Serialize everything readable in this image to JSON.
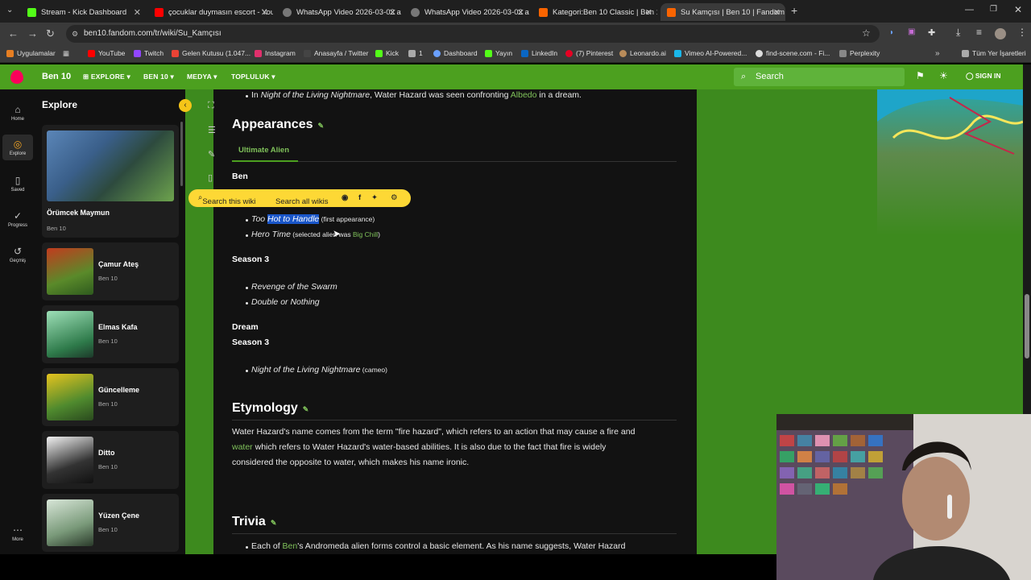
{
  "browser": {
    "tabs": [
      {
        "label": "Stream - Kick Dashboard",
        "color": "#53fc18"
      },
      {
        "label": "çocuklar duymasın escort - You",
        "color": "#ff0000"
      },
      {
        "label": "WhatsApp Video 2026-03-02 at",
        "color": "#888888"
      },
      {
        "label": "WhatsApp Video 2026-03-02 at",
        "color": "#888888"
      },
      {
        "label": "Kategori:Ben 10 Classic | Ben 10",
        "color": "#fa6400"
      },
      {
        "label": "Su Kamçısı | Ben 10 | Fandom",
        "color": "#fa6400"
      }
    ],
    "url": "ben10.fandom.com/tr/wiki/Su_Kamçısı",
    "bookmarks": [
      "Uygulamalar",
      "YouTube",
      "Twitch",
      "Gelen Kutusu (1.047...",
      "Instagram",
      "Anasayfa / Twitter",
      "Kick",
      "1",
      "Dashboard",
      "Yayın",
      "LinkedIn",
      "(7) Pinterest",
      "Leonardo.ai",
      "Vimeo AI-Powered...",
      "find-scene.com - Fi...",
      "Perplexity",
      "Tüm Yer İşaretleri"
    ]
  },
  "fandom": {
    "wiki_name": "Ben 10",
    "nav": [
      "EXPLORE",
      "BEN 10",
      "MEDYA",
      "TOPLULUK"
    ],
    "search_placeholder": "Search",
    "sign_in": "SIGN IN"
  },
  "rail": [
    {
      "label": "Home",
      "icon": "home-icon"
    },
    {
      "label": "Explore",
      "icon": "compass-icon"
    },
    {
      "label": "Saved",
      "icon": "bookmark-icon"
    },
    {
      "label": "Progress",
      "icon": "check-circle-icon"
    },
    {
      "label": "Geçmiş",
      "icon": "history-icon"
    },
    {
      "label": "More",
      "icon": "more-icon"
    }
  ],
  "explore": {
    "title": "Explore",
    "featured": {
      "title": "Örümcek Maymun",
      "sub": "Ben 10"
    },
    "cards": [
      {
        "title": "Çamur Ateş",
        "sub": "Ben 10"
      },
      {
        "title": "Elmas Kafa",
        "sub": "Ben 10"
      },
      {
        "title": "Güncelleme",
        "sub": "Ben 10"
      },
      {
        "title": "Ditto",
        "sub": "Ben 10"
      },
      {
        "title": "Yüzen Çene",
        "sub": "Ben 10"
      }
    ]
  },
  "popup": {
    "search_wiki": "Search this wiki",
    "search_all": "Search all wikis"
  },
  "article": {
    "top_line": {
      "pre": "In ",
      "ep": "Night of the Living Nightmare",
      "mid": ", Water Hazard was seen confronting ",
      "link": "Albedo",
      "post": " in a dream."
    },
    "appearances_title": "Appearances",
    "tab": "Ultimate Alien",
    "ben": "Ben",
    "item1": {
      "pre": "Too ",
      "hl": "Hot to Handle",
      "note": " (first appearance)"
    },
    "item2": {
      "ep": "Hero Time",
      "note_pre": " (selected alien was ",
      "link": "Big Chill",
      "note_post": ")"
    },
    "season3": "Season 3",
    "item3": "Revenge of the Swarm",
    "item4": "Double or Nothing",
    "dream": "Dream",
    "season3b": "Season 3",
    "item5": {
      "ep": "Night of the Living Nightmare",
      "note": " (cameo)"
    },
    "etymology_title": "Etymology",
    "ety1": "Water Hazard's name comes from the term \"fire hazard\", which refers to an action that may cause a fire and",
    "ety2_link": "water",
    "ety2": " which refers to Water Hazard's water-based abilities. It is also due to the fact that fire is widely",
    "ety3": "considered the opposite to water, which makes his name ironic.",
    "trivia_title": "Trivia",
    "trivia1_pre": "Each of ",
    "trivia1_link": "Ben",
    "trivia1_post": "'s Andromeda alien forms control a basic element. As his name suggests, Water Hazard"
  }
}
